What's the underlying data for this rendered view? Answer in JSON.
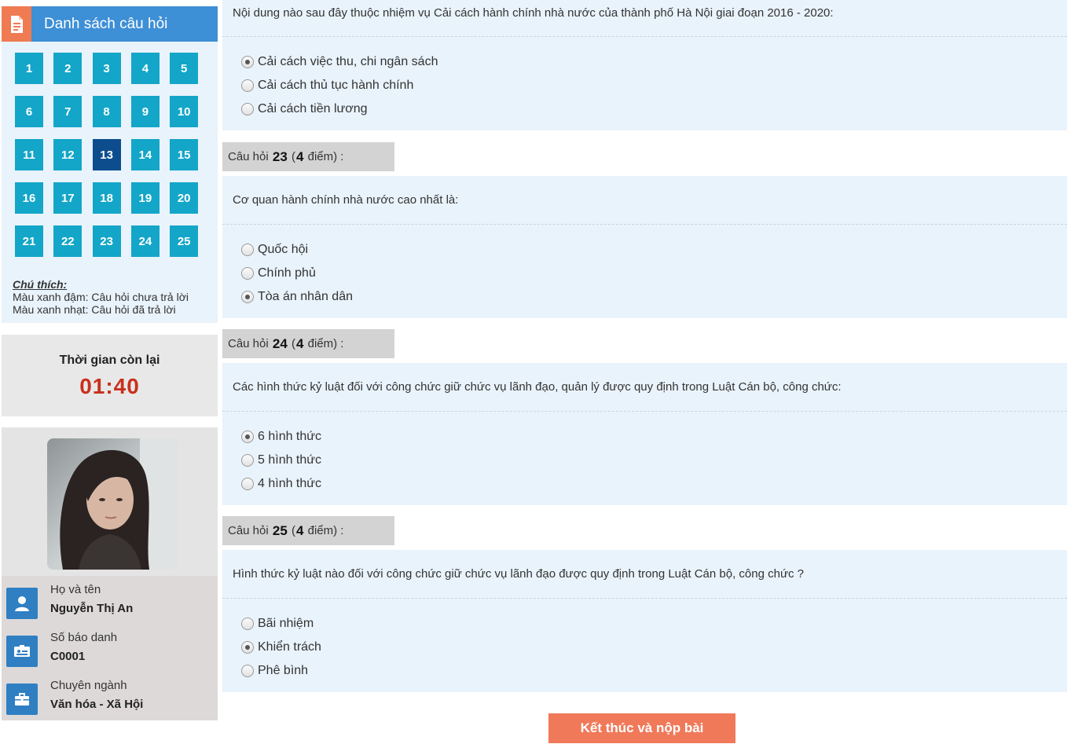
{
  "sidebar": {
    "title": "Danh sách câu hỏi",
    "questions": [
      "1",
      "2",
      "3",
      "4",
      "5",
      "6",
      "7",
      "8",
      "9",
      "10",
      "11",
      "12",
      "13",
      "14",
      "15",
      "16",
      "17",
      "18",
      "19",
      "20",
      "21",
      "22",
      "23",
      "24",
      "25"
    ],
    "current_question": "13",
    "legend": {
      "title": "Chú thích:",
      "dark": "Màu xanh đậm: Câu hỏi chưa trả lời",
      "light": "Màu xanh nhạt: Câu hỏi đã trả lời"
    },
    "colors": {
      "header": "#3d8fd6",
      "tile": "#13a6c8",
      "tile_active": "#0d4d8e",
      "accent": "#f07a52"
    }
  },
  "timer": {
    "label": "Thời gian còn lại",
    "value": "01:40",
    "color": "#c8301d"
  },
  "profile": {
    "name_label": "Họ và tên",
    "name": "Nguyễn Thị An",
    "id_label": "Số báo danh",
    "id": "C0001",
    "major_label": "Chuyên ngành",
    "major": "Văn hóa - Xã Hội",
    "icons": [
      "user-icon",
      "id-card-icon",
      "briefcase-icon"
    ]
  },
  "questions": [
    {
      "prompt": "Nội dung nào sau đây thuộc nhiệm vụ Cải cách hành chính nhà nước của thành phố Hà Nội giai đoạn 2016 - 2020:",
      "options": [
        "Cải cách việc thu, chi ngân sách",
        "Cải cách thủ tục hành chính",
        "Cải cách tiền lương"
      ],
      "selected": 0
    },
    {
      "head_prefix": "Câu hỏi",
      "number": "23",
      "points": "4",
      "head_suffix": "điểm) :",
      "prompt": "Cơ quan hành chính nhà nước cao nhất là:",
      "options": [
        "Quốc hội",
        "Chính phủ",
        "Tòa án nhân dân"
      ],
      "selected": 2
    },
    {
      "head_prefix": "Câu hỏi",
      "number": "24",
      "points": "4",
      "head_suffix": "điểm) :",
      "prompt": "Các hình thức kỷ luật đối với công chức giữ chức vụ lãnh đạo, quản lý được quy định trong Luật Cán bộ, công chức:",
      "options": [
        "6 hình thức",
        "5 hình thức",
        "4 hình thức"
      ],
      "selected": 0
    },
    {
      "head_prefix": "Câu hỏi",
      "number": "25",
      "points": "4",
      "head_suffix": "điểm) :",
      "prompt": "Hình thức kỷ luật nào đối với công chức giữ chức vụ lãnh đạo được quy định trong Luật Cán bộ, công chức ?",
      "options": [
        "Bãi nhiệm",
        "Khiển trách",
        "Phê bình"
      ],
      "selected": 1
    }
  ],
  "submit_label": "Kết thúc và nộp bài",
  "submit_color": "#f0795a"
}
